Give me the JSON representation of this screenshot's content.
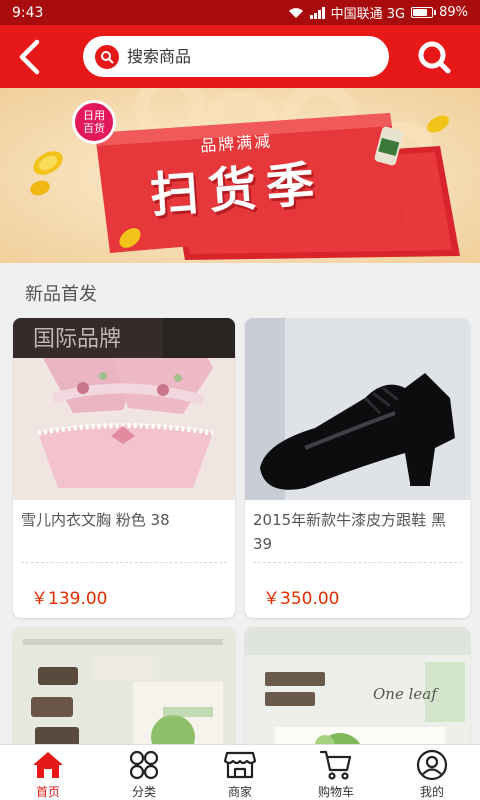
{
  "status_bar": {
    "time": "9:43",
    "carrier": "中国联通 3G",
    "battery": "89%",
    "battery_level": 0.89
  },
  "header": {
    "search_placeholder": "搜索商品",
    "accent": "#e61818"
  },
  "banner": {
    "badge": "日用百货",
    "subtitle": "品牌满减",
    "title": "扫货季"
  },
  "section": {
    "title": "新品首发"
  },
  "products": [
    {
      "name": "雪儿内衣文胸 粉色 38",
      "price": "￥139.00",
      "image": "pink-lingerie-photo"
    },
    {
      "name": "2015年新款牛漆皮方跟鞋 黑 39",
      "price": "￥350.00",
      "image": "black-patent-shoe-photo"
    },
    {
      "name": "",
      "price": "",
      "image": "skincare-boxes-photo"
    },
    {
      "name": "",
      "price": "",
      "image": "one-leaf-skincare-photo"
    }
  ],
  "tabbar": {
    "items": [
      {
        "label": "首页",
        "icon": "home-icon",
        "active": true
      },
      {
        "label": "分类",
        "icon": "category-icon",
        "active": false
      },
      {
        "label": "商家",
        "icon": "shop-icon",
        "active": false
      },
      {
        "label": "购物车",
        "icon": "cart-icon",
        "active": false
      },
      {
        "label": "我的",
        "icon": "user-icon",
        "active": false
      }
    ]
  },
  "colors": {
    "brand_red": "#e61818",
    "price_red": "#e62c00",
    "status_bar": "#a80c0c"
  }
}
